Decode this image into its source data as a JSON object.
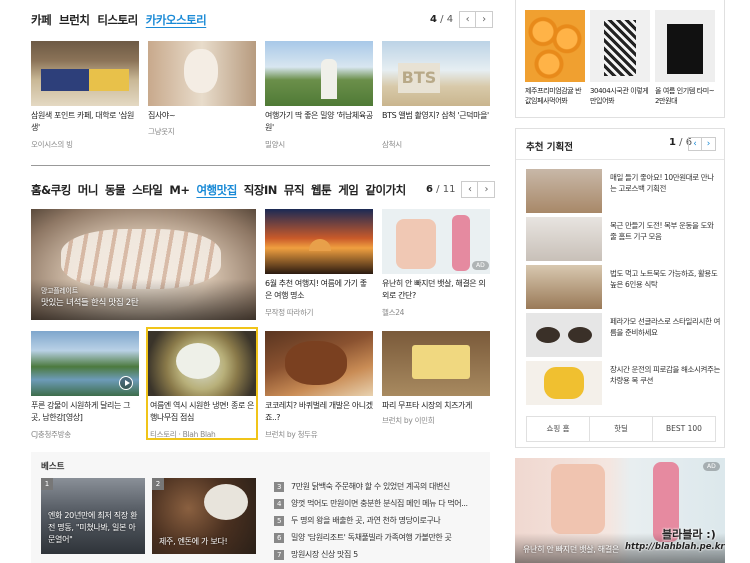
{
  "top": {
    "tabs": [
      "카페",
      "브런치",
      "티스토리",
      "카카오스토리"
    ],
    "active_tab": 3,
    "pager": {
      "current": "4",
      "sep": " / ",
      "total": "4"
    },
    "items": [
      {
        "title": "삼원색 포인트 카페, 대학로 '삼원생'",
        "source": "오이시스의 빙"
      },
      {
        "title": "집사야~",
        "source": "그냥웃지"
      },
      {
        "title": "여행가기 딱 좋은 밀양 '허남체육공원'",
        "source": "밀양시"
      },
      {
        "title": "BTS 앨범 촬영지? 삼척 '근덕마을'",
        "source": "삼척시"
      }
    ]
  },
  "mid": {
    "tabs": [
      "홈&쿠킹",
      "머니",
      "동물",
      "스타일",
      "M+",
      "여행맛집",
      "직장IN",
      "뮤직",
      "웹툰",
      "게임",
      "같이가치"
    ],
    "active_tab": 5,
    "pager": {
      "current": "6",
      "sep": " / ",
      "total": "11"
    },
    "big": {
      "line1": "맛있는 녀석들 한식 맛집 2탄",
      "kicker": "망고플레이트"
    },
    "items": [
      {
        "title": "6월 추천 여행지! 여름에 가기 좋은 여행 명소",
        "source": "무작정 따라하기"
      },
      {
        "title": "유난히 안 빠지던 뱃살, 해결은 의외로 간단?",
        "source": "헬스24"
      },
      {
        "title": "푸른 강물이 시원하게 달리는 그곳, 남한강[영상]",
        "source": "CJ충청주방송"
      },
      {
        "title": "여름엔 역시 시원한 냉면! 종로 은행나무집 점심",
        "source": "티스토리 · Blah Blah"
      },
      {
        "title": "코코레치? 바퀴벌레 개발은 아니겠죠..?",
        "source": "브런치 by 청두유"
      },
      {
        "title": "파리 무프타 시장의 치즈가게",
        "source": "브런치 by 이민희"
      }
    ],
    "ad_label": "AD"
  },
  "best": {
    "heading": "베스트",
    "cards": [
      {
        "num": "1",
        "text": "엔화 20년만에 최저 직장 환전 명동, \"미쳤나봐, 일본 아 문열어\""
      },
      {
        "num": "2",
        "text": "제주, 엔돈에 가 보다!"
      }
    ],
    "list": [
      {
        "num": "3",
        "text": "7만원 닭백숙 주문해야 할 수 있었던 계곡의 대변신"
      },
      {
        "num": "4",
        "text": "양껏 먹어도 만원이면 충분한 분식집 메인 메뉴 다 먹어..."
      },
      {
        "num": "5",
        "text": "두 명의 왕을 배출한 곳, 과연 천하 명당이로구나"
      },
      {
        "num": "6",
        "text": "밀양 '담원리조트' 독채풀빌라 가족여행 가볼만한 곳"
      },
      {
        "num": "7",
        "text": "망원시장 신상 맛집 5"
      }
    ]
  },
  "right": {
    "shop": [
      {
        "title": "제주프리미엄감귤 반값임페사먹어봐"
      },
      {
        "title": "30404시국관 이렇게만입어봐"
      },
      {
        "title": "올 여름 인기템 타미~ 2만원대"
      }
    ],
    "rec": {
      "heading": "추천 기획전",
      "pager": {
        "current": "1",
        "sep": " / ",
        "total": "6"
      },
      "items": [
        {
          "title": "매일 들기 좋아요! 10만원대로 만나는 고로스백 기획전"
        },
        {
          "title": "복근 만들기 도전! 복부 운동을 도와줄 홈트 기구 모음"
        },
        {
          "title": "법도 먹고 노트북도 가능하죠, 활용도 높은 6인용 식탁"
        },
        {
          "title": "페라가모 선글라스로 스타일리시한 여름을 준비하세요"
        },
        {
          "title": "장시간 운전의 피로감을 해소시켜주는 차량용 목 쿠션"
        }
      ],
      "buttons": [
        "쇼핑 홈",
        "핫딜",
        "BEST 100"
      ]
    },
    "banner": {
      "text": "유난히 안 빠지던 뱃살, 해결은",
      "ad": "AD"
    }
  },
  "watermark": {
    "line1": "블라블라 :)",
    "line2": "http://blahblah.pe.kr"
  }
}
